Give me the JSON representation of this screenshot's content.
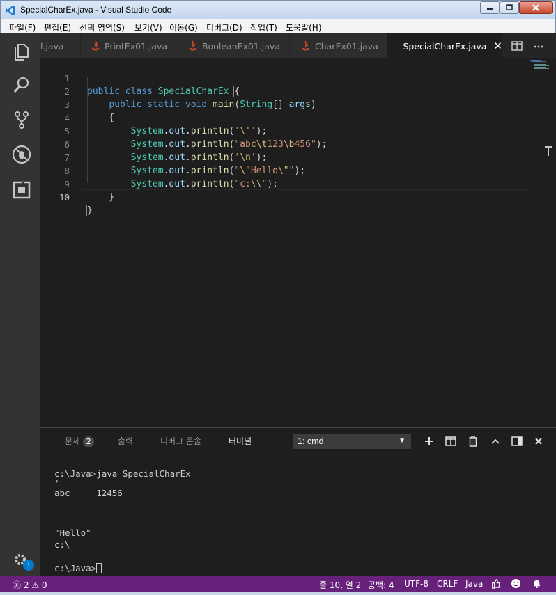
{
  "window": {
    "title": "SpecialCharEx.java - Visual Studio Code",
    "icon": "vscode-logo-icon"
  },
  "menu": [
    "파일(F)",
    "편집(E)",
    "선택 영역(S)",
    "보기(V)",
    "이동(G)",
    "디버그(D)",
    "작업(T)",
    "도움말(H)"
  ],
  "activity_bar": {
    "icons": [
      "explorer-icon",
      "search-icon",
      "source-control-icon",
      "debug-icon",
      "extensions-icon"
    ],
    "settings_icon": "gear-icon",
    "settings_badge": "1"
  },
  "tabs": [
    {
      "label": "l.java",
      "active": false
    },
    {
      "label": "PrintEx01.java",
      "active": false
    },
    {
      "label": "BooleanEx01.java",
      "active": false
    },
    {
      "label": "CharEx01.java",
      "active": false
    },
    {
      "label": "SpecialCharEx.java",
      "active": true
    }
  ],
  "editor": {
    "line_numbers": [
      "1",
      "2",
      "3",
      "4",
      "5",
      "6",
      "7",
      "8",
      "9",
      "10"
    ],
    "current_line": "10",
    "lines": [
      "public class SpecialCharEx {",
      "    public static void main(String[] args)",
      "    {",
      "        System.out.println('\\'');",
      "        System.out.println(\"abc\\t123\\b456\");",
      "        System.out.println('\\n');",
      "        System.out.println(\"\\\"Hello\\\"\");",
      "        System.out.println(\"c:\\\\\");",
      "    }",
      "}"
    ]
  },
  "panel": {
    "tabs": {
      "problems": "문제",
      "problems_count": "2",
      "output": "출력",
      "debug_console": "디버그 콘솔",
      "terminal": "터미널"
    },
    "active_tab": "터미널",
    "terminal_select": "1: cmd",
    "terminal_lines": [
      "c:\\Java>java SpecialCharEx",
      "'",
      "abc     12456",
      "",
      "",
      "\"Hello\"",
      "c:\\",
      "",
      "c:\\Java>"
    ]
  },
  "status_bar": {
    "errors": "2",
    "warnings": "0",
    "position": "줄 10, 열 2",
    "spaces": "공백: 4",
    "encoding": "UTF-8",
    "eol": "CRLF",
    "language": "Java"
  },
  "colors": {
    "status_bar": "#68217a",
    "editor_bg": "#1e1e1e",
    "activity_bar": "#333333",
    "keyword": "#569cd6",
    "class": "#4ec9b0",
    "string": "#ce9178"
  }
}
